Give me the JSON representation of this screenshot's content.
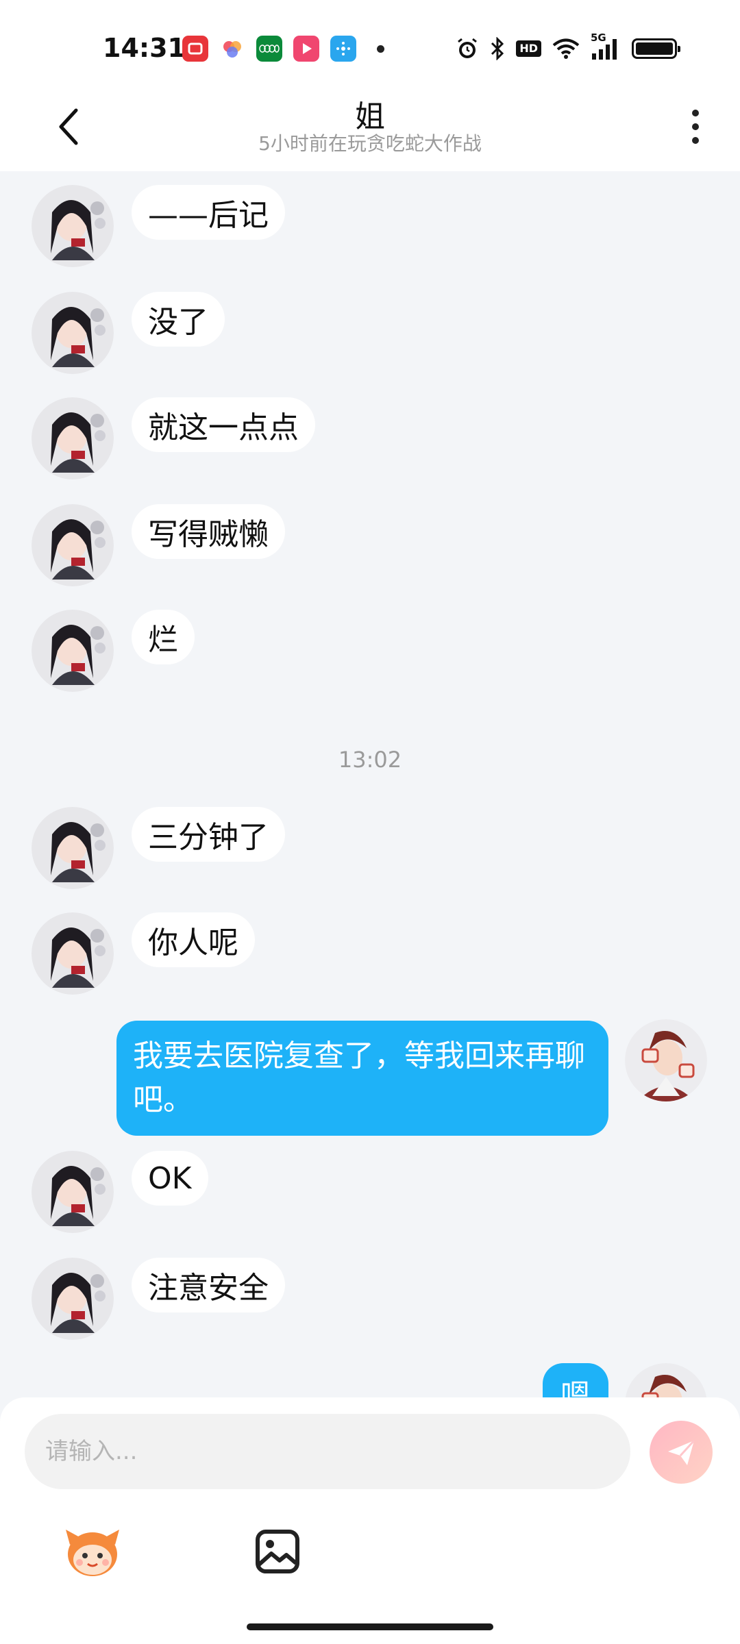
{
  "status_bar": {
    "time": "14:31",
    "network": "5G",
    "hd_label": "HD",
    "icons": [
      "video-app-icon",
      "color-app-icon",
      "oppo-app-icon",
      "play-app-icon",
      "tplink-app-icon",
      "alarm-icon",
      "bluetooth-icon",
      "wifi-icon",
      "signal-icon",
      "battery-icon"
    ]
  },
  "header": {
    "title": "姐",
    "subtitle": "5小时前在玩贪吃蛇大作战"
  },
  "messages": [
    {
      "from": "other",
      "text": "——后记"
    },
    {
      "from": "other",
      "text": "没了"
    },
    {
      "from": "other",
      "text": "就这一点点"
    },
    {
      "from": "other",
      "text": "写得贼懒"
    },
    {
      "from": "other",
      "text": "烂"
    },
    {
      "type": "time",
      "text": "13:02"
    },
    {
      "from": "other",
      "text": "三分钟了"
    },
    {
      "from": "other",
      "text": "你人呢"
    },
    {
      "from": "me",
      "text": "我要去医院复查了，等我回来再聊吧。"
    },
    {
      "from": "other",
      "text": "OK"
    },
    {
      "from": "other",
      "text": "注意安全"
    },
    {
      "from": "me",
      "text": "嗯"
    }
  ],
  "input": {
    "placeholder": "请输入..."
  },
  "colors": {
    "outgoing_bubble": "#1eb2f8",
    "incoming_bubble": "#ffffff",
    "background": "#f3f5f8",
    "send_button": "#ffc1c6"
  }
}
